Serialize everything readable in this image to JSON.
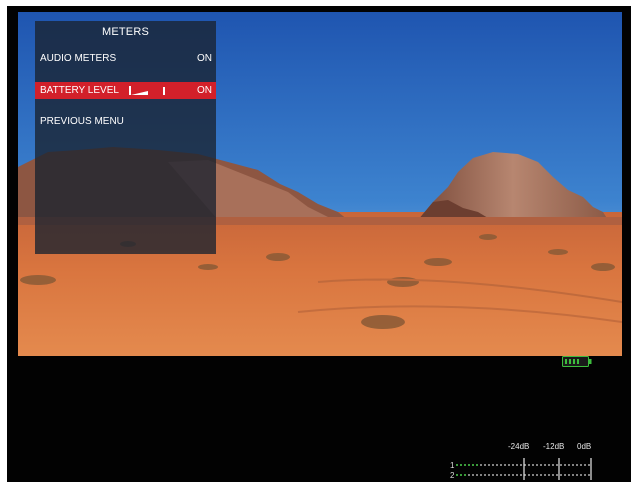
{
  "menu": {
    "title": "METERS",
    "items": [
      {
        "label": "AUDIO METERS",
        "value": "ON",
        "selected": false
      },
      {
        "label": "BATTERY LEVEL",
        "value": "ON",
        "selected": true
      },
      {
        "label": "PREVIOUS MENU",
        "value": "",
        "selected": false
      }
    ]
  },
  "audio_meter": {
    "scale_labels": [
      "-24dB",
      "-12dB",
      "0dB"
    ],
    "channels": [
      "1",
      "2"
    ]
  },
  "colors": {
    "selected_row": "#d2202a",
    "battery": "#3dbd3d",
    "meter_level": "#3dbd3d"
  }
}
